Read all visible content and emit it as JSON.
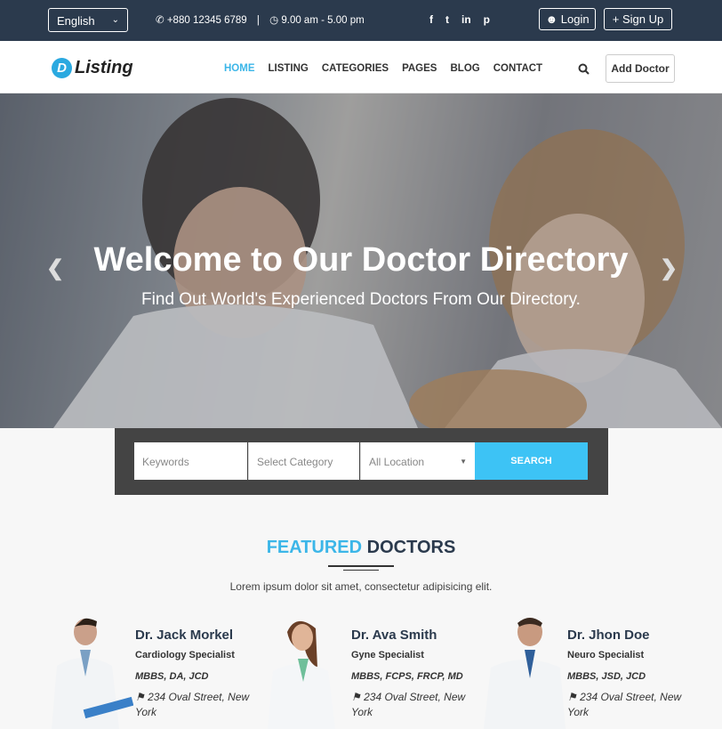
{
  "topbar": {
    "language": "English",
    "phone": "+880 12345 6789",
    "hours": "9.00 am - 5.00 pm",
    "social": [
      "f",
      "t",
      "in",
      "p"
    ],
    "login": "Login",
    "signup": "Sign Up"
  },
  "nav": {
    "logo_letter": "D",
    "logo_text": "Listing",
    "items": [
      "HOME",
      "LISTING",
      "CATEGORIES",
      "PAGES",
      "BLOG",
      "CONTACT"
    ],
    "active": "HOME",
    "add_doctor": "Add Doctor"
  },
  "hero": {
    "title": "Welcome to Our Doctor Directory",
    "subtitle": "Find Out World's Experienced Doctors From Our Directory."
  },
  "search": {
    "keywords_placeholder": "Keywords",
    "category": "Select Category",
    "location": "All Location",
    "button": "SEARCH"
  },
  "featured": {
    "title_highlight": "FEATURED",
    "title_rest": "DOCTORS",
    "subtitle": "Lorem ipsum dolor sit amet, consectetur adipisicing elit."
  },
  "doctors": [
    {
      "name": "Dr. Jack Morkel",
      "specialty": "Cardiology Specialist",
      "degrees": "MBBS, DA, JCD",
      "address": "234 Oval Street, New York"
    },
    {
      "name": "Dr. Ava Smith",
      "specialty": "Gyne Specialist",
      "degrees": "MBBS, FCPS, FRCP, MD",
      "address": "234 Oval Street, New York"
    },
    {
      "name": "Dr. Jhon Doe",
      "specialty": "Neuro Specialist",
      "degrees": "MBBS, JSD, JCD",
      "address": "234 Oval Street, New York"
    }
  ],
  "colors": {
    "accent": "#3cb6e8",
    "topbar": "#2b3a4d",
    "search_button": "#3dc3f5"
  }
}
